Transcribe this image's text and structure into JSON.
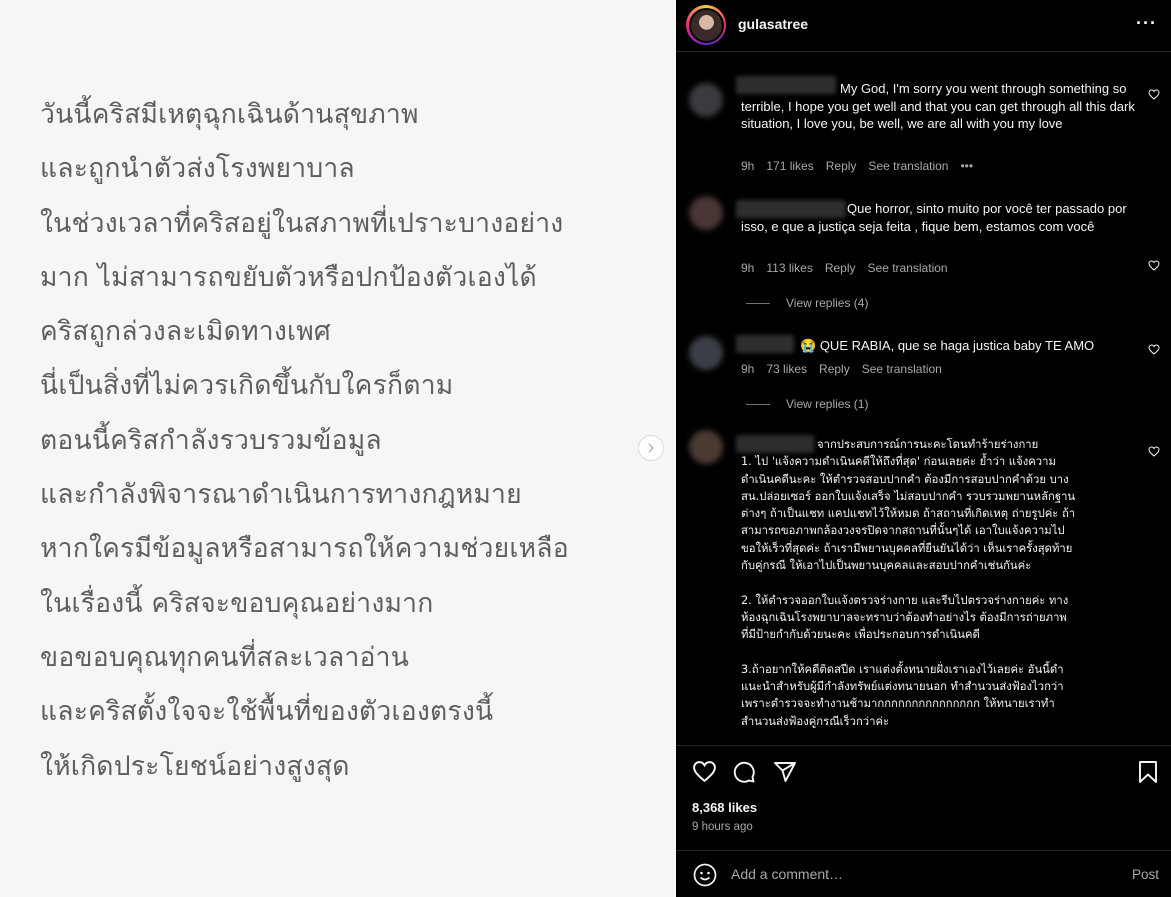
{
  "image": {
    "lines": [
      "วันนี้คริสมีเหตุฉุกเฉินด้านสุขภาพ",
      "และถูกนำตัวส่งโรงพยาบาล",
      "ในช่วงเวลาที่คริสอยู่ในสภาพที่เปราะบางอย่าง",
      "มาก ไม่สามารถขยับตัวหรือปกป้องตัวเองได้",
      "คริสถูกล่วงละเมิดทางเพศ",
      "นี่เป็นสิ่งที่ไม่ควรเกิดขึ้นกับใครก็ตาม",
      "ตอนนี้คริสกำลังรวบรวมข้อมูล",
      "และกำลังพิจารณาดำเนินการทางกฎหมาย",
      "หากใครมีข้อมูลหรือสามารถให้ความช่วยเหลือ",
      "ในเรื่องนี้ คริสจะขอบคุณอย่างมาก",
      "ขอขอบคุณทุกคนที่สละเวลาอ่าน",
      "และคริสตั้งใจจะใช้พื้นที่ของตัวเองตรงนี้",
      "ให้เกิดประโยชน์อย่างสูงสุด"
    ]
  },
  "header": {
    "username": "gulasatree"
  },
  "comments": [
    {
      "text": "My God, I'm sorry you went through something so terrible, I hope you get well and that you can get through all this dark situation, I love you, be well, we are all with you my love",
      "time": "9h",
      "likes": "171 likes",
      "reply": "Reply",
      "translate": "See translation",
      "more": "•••"
    },
    {
      "text": "Que horror, sinto muito por você ter passado por isso, e que a justiça seja feita , fique bem, estamos com você",
      "time": "9h",
      "likes": "113 likes",
      "reply": "Reply",
      "translate": "See translation",
      "view_replies": "View replies (4)"
    },
    {
      "emoji": "😭",
      "text": "QUE RABIA, que se haga justica baby TE AMO",
      "time": "9h",
      "likes": "73 likes",
      "reply": "Reply",
      "translate": "See translation",
      "view_replies": "View replies (1)"
    },
    {
      "lines": [
        "จากประสบการณ์การนะคะโดนทำร้ายร่างกาย",
        "1. ไป 'แจ้งความดำเนินคดีให้ถึงที่สุด' ก่อนเลยค่ะ ย้ำว่า แจ้งความ",
        "ดำเนินคดีนะคะ ให้ตำรวจสอบปากคำ ต้องมีการสอบปากคำด้วย บาง",
        "สน.ปล่อยเซอร์ ออกใบแจ้งเสร็จ ไม่สอบปากคำ รวบรวมพยานหลักฐาน",
        "ต่างๆ ถ้าเป็นแชท แคปแชทไว้ให้หมด ถ้าสถานที่เกิดเหตุ ถ่ายรูปค่ะ ถ้า",
        "สามารถขอภาพกล้องวงจรปิดจากสถานที่นั้นๆได้ เอาใบแจ้งความไป",
        "ขอให้เร็วที่สุดค่ะ ถ้าเรามีพยานบุคคลที่ยืนยันได้ว่า เห็นเราครั้งสุดท้าย",
        "กับคู่กรณี ให้เอาไปเป็นพยานบุคคลและสอบปากคำเช่นกันค่ะ",
        "",
        "2. ให้ตำรวจออกใบแจ้งตรวจร่างกาย และรีบไปตรวจร่างกายค่ะ ทาง",
        "ห้องฉุกเฉินโรงพยาบาลจะทราบว่าต้องทำอย่างไร ต้องมีการถ่ายภาพ",
        "ที่มีป้ายกำกับด้วยนะคะ เพื่อประกอบการดำเนินคดี",
        "",
        "3.ถ้าอยากให้คดีติดสปีด เราแต่งตั้งทนายฝั่งเราเองไว้เลยค่ะ อันนี้ดำ",
        "แนะนำสำหรับผู้มีกำลังทรัพย์แต่งทนายนอก ทำสำนวนส่งฟ้องไวกว่า",
        "เพราะตำรวจจะทำงานช้ามากกกกกกกกกกกกกกก ให้ทนายเราทำ",
        "สำนวนส่งฟ้องคู่กรณีเร็วกว่าค่ะ"
      ]
    }
  ],
  "footer": {
    "likes": "8,368 likes",
    "time": "9 hours ago",
    "comment_placeholder": "Add a comment…",
    "post_label": "Post"
  },
  "colors": {
    "background": "#000000",
    "secondary_text": "#a8a8a8",
    "image_bg": "#f6f6f6",
    "image_text": "#5e5e5e"
  }
}
